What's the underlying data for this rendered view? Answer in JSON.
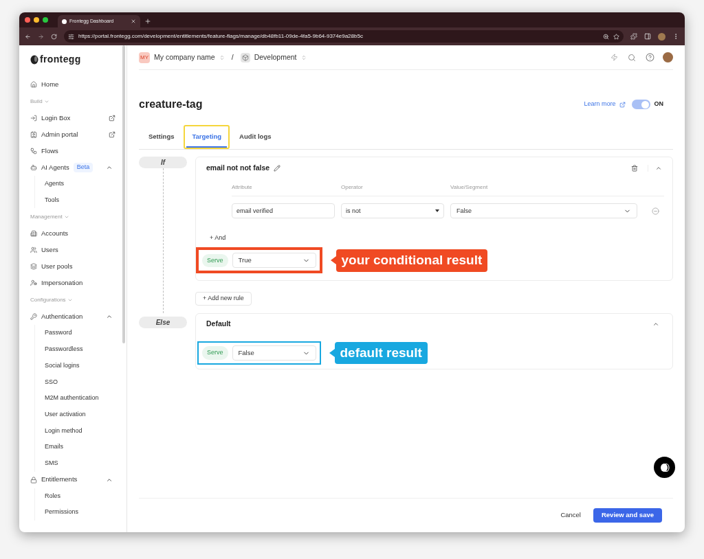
{
  "browser": {
    "tab_title": "Frontegg Dashboard",
    "url": "https://portal.frontegg.com/development/entitlements/feature-flags/manage/db48fb11-09de-4fa5-9b64-9374e9a28b5c"
  },
  "sidebar": {
    "logo": "frontegg",
    "items": [
      {
        "kind": "link",
        "label": "Home",
        "external": false
      },
      {
        "kind": "section",
        "label": "Build"
      },
      {
        "kind": "link",
        "label": "Login Box",
        "external": true
      },
      {
        "kind": "link",
        "label": "Admin portal",
        "external": true
      },
      {
        "kind": "link",
        "label": "Flows",
        "external": false
      },
      {
        "kind": "group",
        "label": "AI Agents",
        "badge": "Beta",
        "expanded": true,
        "children": [
          {
            "label": "Agents"
          },
          {
            "label": "Tools"
          }
        ]
      },
      {
        "kind": "section",
        "label": "Management"
      },
      {
        "kind": "link",
        "label": "Accounts",
        "external": false
      },
      {
        "kind": "link",
        "label": "Users",
        "external": false
      },
      {
        "kind": "link",
        "label": "User pools",
        "external": false
      },
      {
        "kind": "link",
        "label": "Impersonation",
        "external": false
      },
      {
        "kind": "section",
        "label": "Configurations"
      },
      {
        "kind": "group",
        "label": "Authentication",
        "expanded": true,
        "children": [
          {
            "label": "Password"
          },
          {
            "label": "Passwordless"
          },
          {
            "label": "Social logins"
          },
          {
            "label": "SSO"
          },
          {
            "label": "M2M authentication"
          },
          {
            "label": "User activation"
          },
          {
            "label": "Login method"
          },
          {
            "label": "Emails"
          },
          {
            "label": "SMS"
          }
        ]
      },
      {
        "kind": "group",
        "label": "Entitlements",
        "expanded": true,
        "children": [
          {
            "label": "Roles"
          },
          {
            "label": "Permissions"
          }
        ]
      }
    ]
  },
  "header": {
    "company_badge": "MY",
    "company": "My company name",
    "separator": "/",
    "environment": "Development"
  },
  "page": {
    "title": "creature-tag",
    "learn_more": "Learn more",
    "toggle": {
      "on": true,
      "label": "ON"
    },
    "tabs": [
      {
        "label": "Settings",
        "selected": false,
        "highlighted": false
      },
      {
        "label": "Targeting",
        "selected": true,
        "highlighted": true
      },
      {
        "label": "Audit logs",
        "selected": false,
        "highlighted": false
      }
    ]
  },
  "targeting": {
    "if_label": "If",
    "else_label": "Else",
    "rule": {
      "name": "email not not false",
      "expanded": true,
      "columns": [
        "Attribute",
        "Operator",
        "Value/Segment"
      ],
      "condition": {
        "attribute": "email verified",
        "operator": "is not",
        "value": "False"
      },
      "and_label": "+ And",
      "serve": {
        "badge": "Serve",
        "value": "True",
        "annotation": {
          "text": "your conditional result",
          "color": "#f04a23"
        }
      }
    },
    "add_rule": "+ Add new rule",
    "default": {
      "title": "Default",
      "expanded": true,
      "serve": {
        "badge": "Serve",
        "value": "False",
        "annotation": {
          "text": "default result",
          "color": "#18a8e0"
        }
      }
    }
  },
  "footer": {
    "cancel": "Cancel",
    "save": "Review and save"
  }
}
